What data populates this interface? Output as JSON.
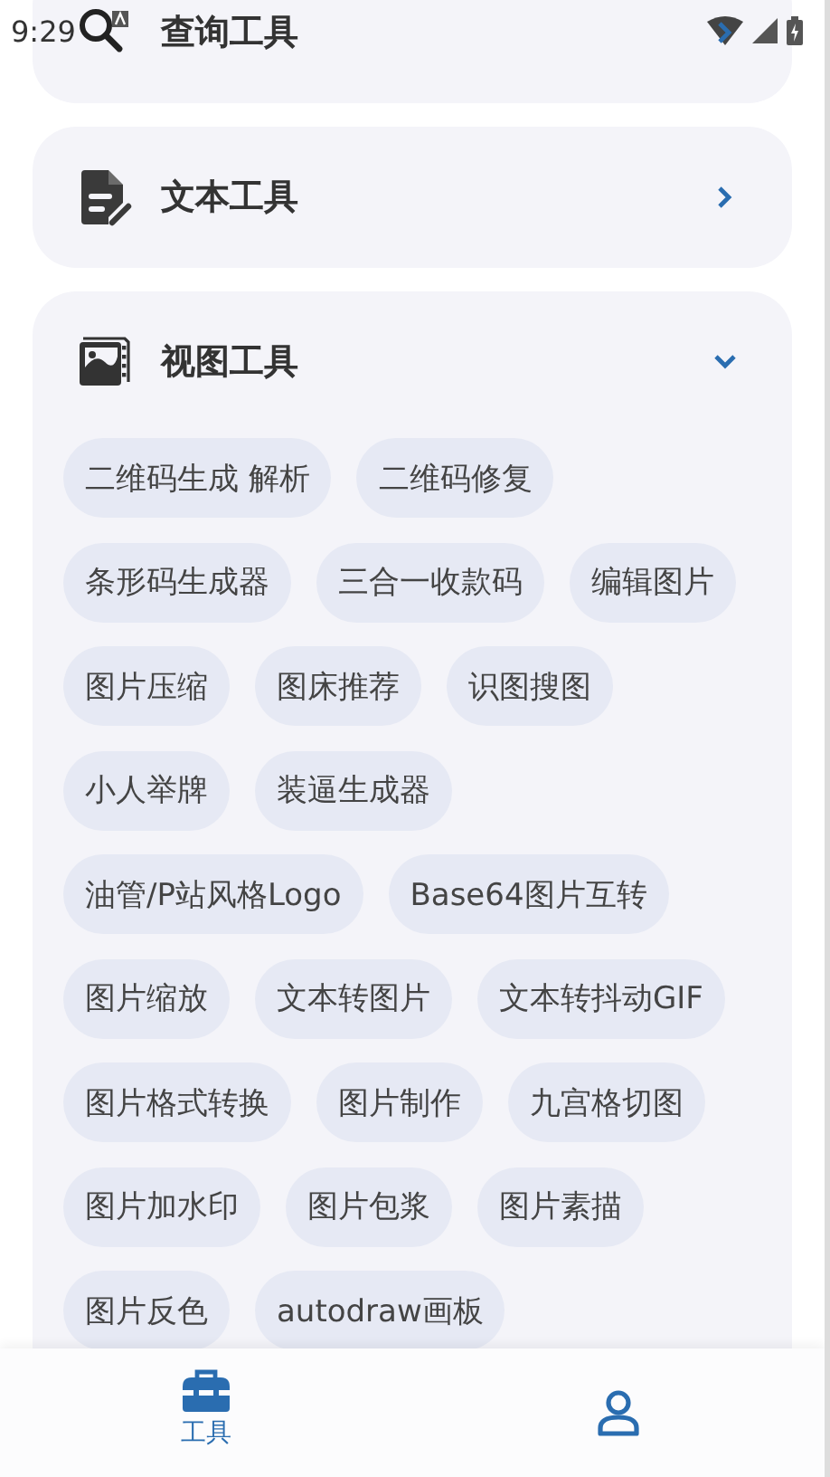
{
  "status_bar": {
    "time": "9:29"
  },
  "categories": [
    {
      "title": "查询工具",
      "kind": "search",
      "expanded": false
    },
    {
      "title": "文本工具",
      "kind": "document",
      "expanded": false
    },
    {
      "title": "视图工具",
      "kind": "image",
      "expanded": true,
      "tools": [
        "二维码生成 解析",
        "二维码修复",
        "条形码生成器",
        "三合一收款码",
        "编辑图片",
        "图片压缩",
        "图床推荐",
        "识图搜图",
        "小人举牌",
        "装逼生成器",
        "油管/P站风格Logo",
        "Base64图片互转",
        "图片缩放",
        "文本转图片",
        "文本转抖动GIF",
        "图片格式转换",
        "图片制作",
        "九宫格切图",
        "图片加水印",
        "图片包浆",
        "图片素描",
        "图片反色",
        "autodraw画板"
      ]
    }
  ],
  "bottom_nav": [
    {
      "label": "工具",
      "kind": "toolbox",
      "selected": true
    },
    {
      "kind": "person",
      "selected": false
    }
  ]
}
